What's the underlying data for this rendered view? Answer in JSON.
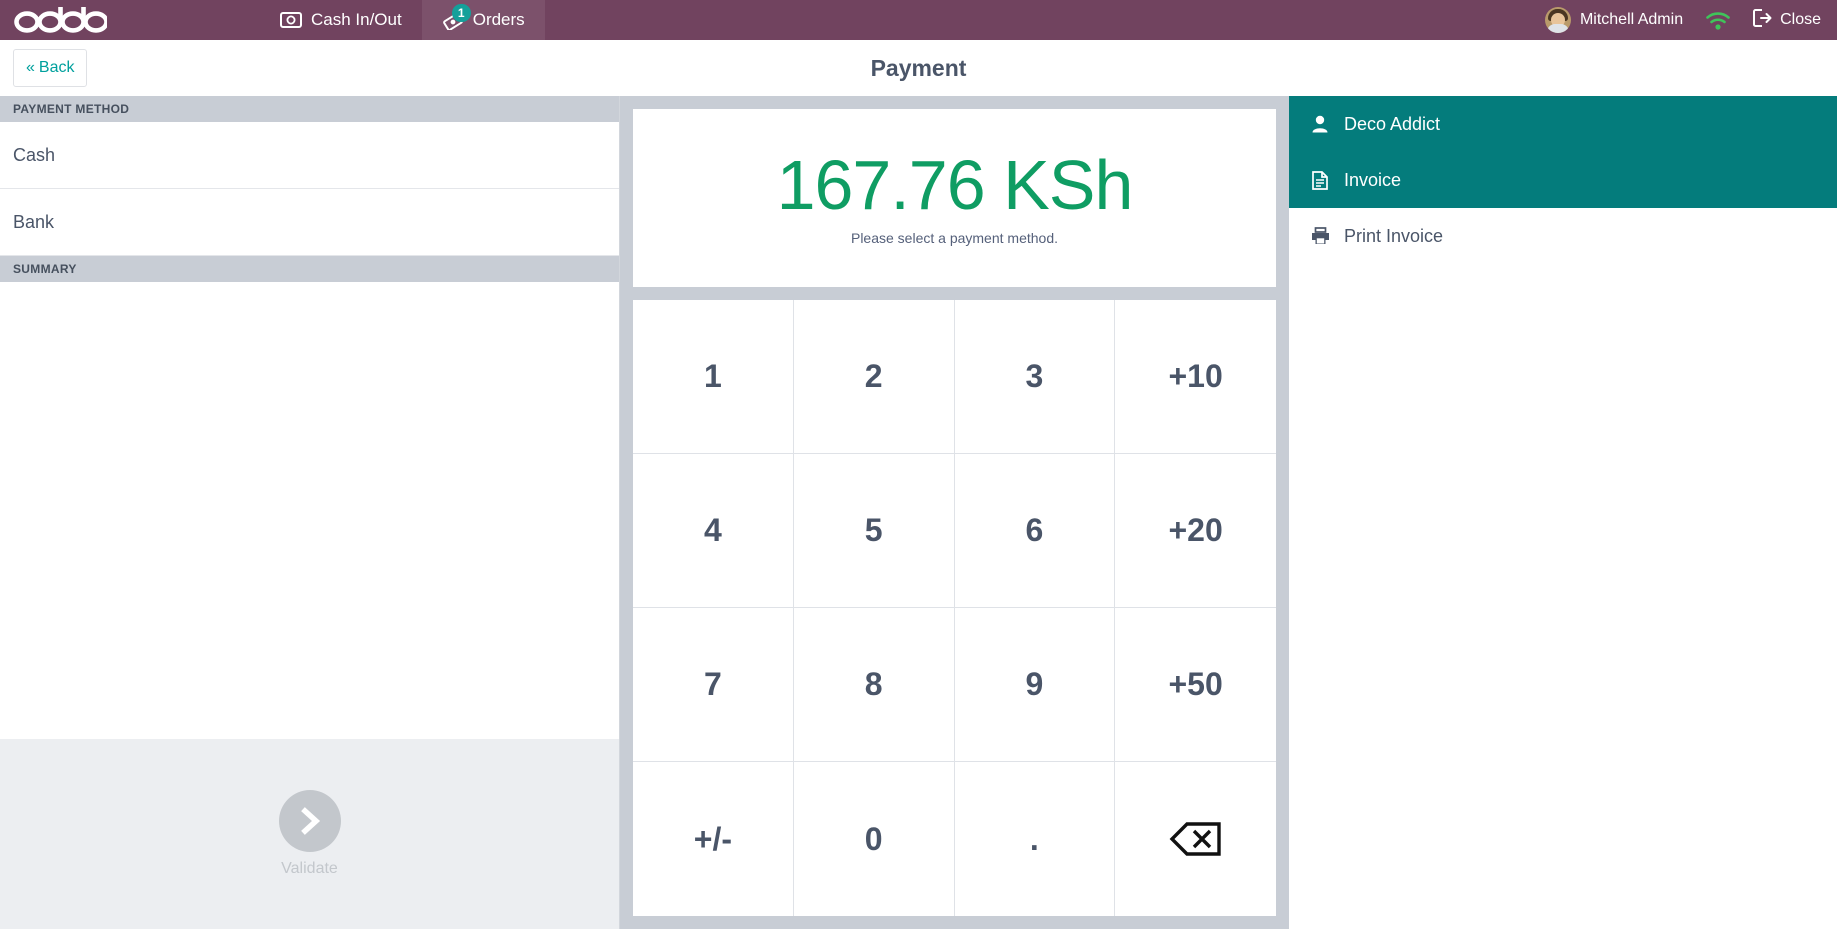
{
  "topbar": {
    "logo_text": "odoo",
    "tabs": [
      {
        "label": "Cash In/Out",
        "icon": "banknote-icon",
        "badge": null,
        "active": false
      },
      {
        "label": "Orders",
        "icon": "receipt-icon",
        "badge": "1",
        "active": true
      }
    ],
    "user_name": "Mitchell Admin",
    "close_label": "Close",
    "wifi_icon": "wifi-icon",
    "colors": {
      "bar": "#71435f",
      "badge": "#15a09a"
    }
  },
  "subheader": {
    "back_label": "Back",
    "back_chevrons": "«",
    "page_title": "Payment"
  },
  "left": {
    "payment_method_header": "PAYMENT METHOD",
    "payment_methods": [
      {
        "label": "Cash"
      },
      {
        "label": "Bank"
      }
    ],
    "summary_header": "SUMMARY",
    "validate_label": "Validate",
    "validate_icon": "chevron-right-icon",
    "validate_enabled": false
  },
  "center": {
    "amount": "167.76 KSh",
    "hint": "Please select a payment method.",
    "amount_color": "#0f9d63",
    "numpad": [
      {
        "label": "1",
        "name": "numpad-key-1"
      },
      {
        "label": "2",
        "name": "numpad-key-2"
      },
      {
        "label": "3",
        "name": "numpad-key-3"
      },
      {
        "label": "+10",
        "name": "numpad-key-plus-10"
      },
      {
        "label": "4",
        "name": "numpad-key-4"
      },
      {
        "label": "5",
        "name": "numpad-key-5"
      },
      {
        "label": "6",
        "name": "numpad-key-6"
      },
      {
        "label": "+20",
        "name": "numpad-key-plus-20"
      },
      {
        "label": "7",
        "name": "numpad-key-7"
      },
      {
        "label": "8",
        "name": "numpad-key-8"
      },
      {
        "label": "9",
        "name": "numpad-key-9"
      },
      {
        "label": "+50",
        "name": "numpad-key-plus-50"
      },
      {
        "label": "+/-",
        "name": "numpad-key-sign-toggle"
      },
      {
        "label": "0",
        "name": "numpad-key-0"
      },
      {
        "label": ".",
        "name": "numpad-key-decimal"
      },
      {
        "label": "",
        "name": "numpad-key-backspace",
        "icon": "backspace-icon"
      }
    ]
  },
  "right": {
    "items": [
      {
        "label": "Deco Addict",
        "icon": "user-icon",
        "style": "teal",
        "name": "customer-button"
      },
      {
        "label": "Invoice",
        "icon": "document-icon",
        "style": "teal",
        "name": "invoice-toggle"
      },
      {
        "label": "Print Invoice",
        "icon": "printer-icon",
        "style": "plain",
        "name": "print-invoice-button"
      }
    ],
    "accent": "#047c7c"
  }
}
